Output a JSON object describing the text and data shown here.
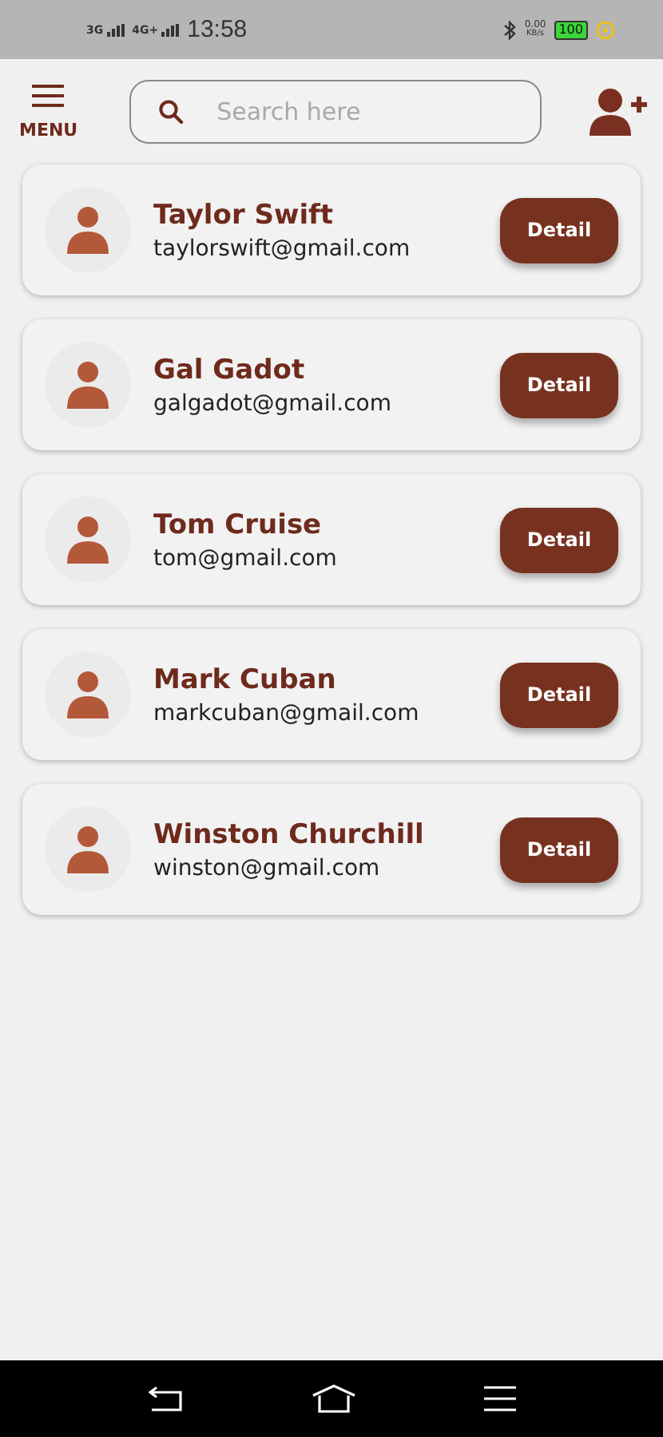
{
  "status_bar": {
    "network_1": "3G",
    "network_2": "4G+",
    "time": "13:58",
    "speed": "0.00",
    "speed_unit": "KB/s",
    "battery": "100"
  },
  "header": {
    "menu_label": "MENU",
    "search": {
      "placeholder": "Search here"
    }
  },
  "contacts": [
    {
      "name": "Taylor Swift",
      "email": "taylorswift@gmail.com",
      "button": "Detail"
    },
    {
      "name": "Gal Gadot",
      "email": "galgadot@gmail.com",
      "button": "Detail"
    },
    {
      "name": "Tom Cruise",
      "email": "tom@gmail.com",
      "button": "Detail"
    },
    {
      "name": "Mark Cuban",
      "email": "markcuban@gmail.com",
      "button": "Detail"
    },
    {
      "name": "Winston Churchill",
      "email": "winston@gmail.com",
      "button": "Detail"
    }
  ]
}
